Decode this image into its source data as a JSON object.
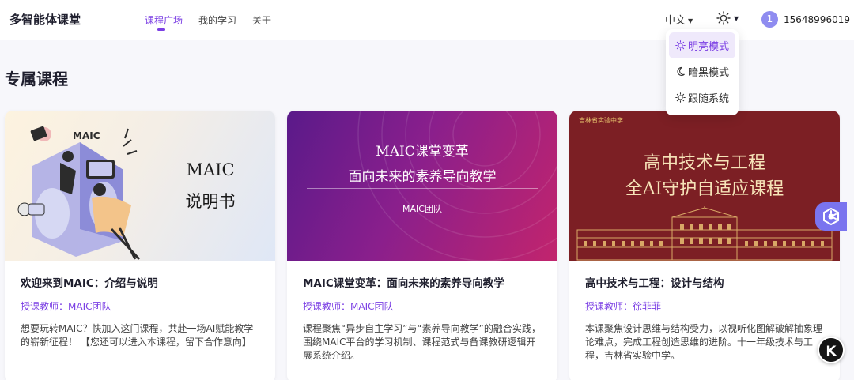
{
  "app": {
    "logo": "多智能体课堂"
  },
  "nav": {
    "items": [
      {
        "label": "课程广场",
        "active": true
      },
      {
        "label": "我的学习",
        "active": false
      },
      {
        "label": "关于",
        "active": false
      }
    ]
  },
  "header": {
    "language": "中文",
    "theme_icon": "sun-icon",
    "user": {
      "avatar_text": "1",
      "phone": "15648996019"
    }
  },
  "theme_menu": {
    "items": [
      {
        "label": "明亮模式",
        "icon": "sun-icon",
        "active": true
      },
      {
        "label": "暗黑模式",
        "icon": "moon-icon",
        "active": false
      },
      {
        "label": "跟随系统",
        "icon": "sun-icon",
        "active": false
      }
    ]
  },
  "section": {
    "title": "专属课程"
  },
  "courses": [
    {
      "cover": {
        "line1": "MAIC",
        "line2": "说明书",
        "art_text": "MAIC"
      },
      "title": "欢迎来到MAIC：介绍与说明",
      "teacher": "授课教师：MAIC团队",
      "description": "想要玩转MAIC？快加入这门课程，共赴一场AI赋能教学的崭新征程！ 【您还可以进入本课程，留下合作意向】"
    },
    {
      "cover": {
        "line1": "MAIC课堂变革",
        "line2": "面向未来的素养导向教学",
        "team": "MAIC团队"
      },
      "title": "MAIC课堂变革：面向未来的素养导向教学",
      "teacher": "授课教师：MAIC团队",
      "description": "课程聚焦“异步自主学习”与“素养导向教学”的融合实践，围绕MAIC平台的学习机制、课程范式与备课教研逻辑开展系统介绍。"
    },
    {
      "cover": {
        "school": "吉林省实验中学",
        "line1": "高中技术与工程",
        "line2": "全AI守护自适应课程"
      },
      "title": "高中技术与工程：设计与结构",
      "teacher": "授课教师：徐菲菲",
      "description": "本课聚焦设计思维与结构受力，以视听化图解破解抽象理论难点，完成工程创造思维的进阶。十一年级技术与工程，吉林省实验中学。"
    }
  ],
  "floating": {
    "assistant_icon": "assistant-icon",
    "k_label": "K"
  },
  "colors": {
    "accent": "#7b3fe4",
    "avatar": "#8f8cf0",
    "float_button": "#7a74ef"
  }
}
